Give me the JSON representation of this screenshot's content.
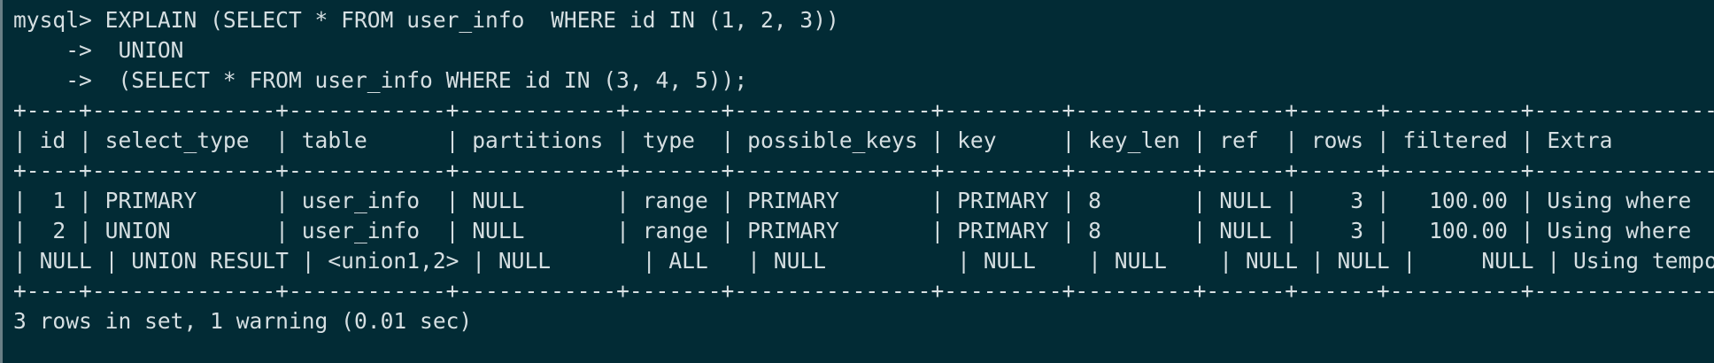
{
  "terminal": {
    "lines": [
      "mysql> EXPLAIN (SELECT * FROM user_info  WHERE id IN (1, 2, 3))",
      "    ->  UNION",
      "    ->  (SELECT * FROM user_info WHERE id IN (3, 4, 5));",
      "+----+--------------+------------+------------+-------+---------------+---------+---------+------+------+----------+-----------------+",
      "| id | select_type  | table      | partitions | type  | possible_keys | key     | key_len | ref  | rows | filtered | Extra           |",
      "+----+--------------+------------+------------+-------+---------------+---------+---------+------+------+----------+-----------------+",
      "|  1 | PRIMARY      | user_info  | NULL       | range | PRIMARY       | PRIMARY | 8       | NULL |    3 |   100.00 | Using where     |",
      "|  2 | UNION        | user_info  | NULL       | range | PRIMARY       | PRIMARY | 8       | NULL |    3 |   100.00 | Using where     |",
      "| NULL | UNION RESULT | <union1,2> | NULL       | ALL   | NULL          | NULL    | NULL    | NULL | NULL |     NULL | Using temporary |",
      "+----+--------------+------------+------------+-------+---------------+---------+---------+------+------+----------+-----------------+",
      "3 rows in set, 1 warning (0.01 sec)"
    ]
  }
}
